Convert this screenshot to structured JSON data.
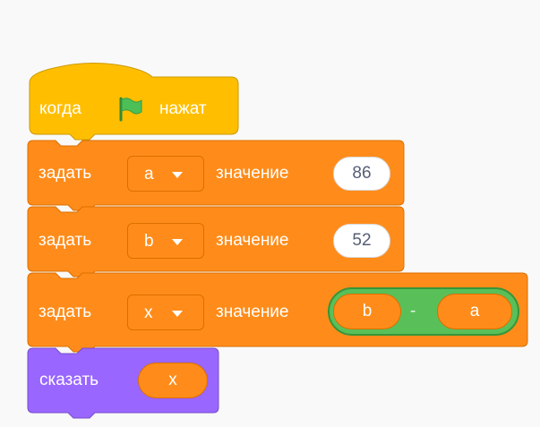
{
  "script": {
    "hat": {
      "prefix": "когда",
      "flag_icon": "green-flag-icon",
      "suffix": "нажат"
    },
    "set_blocks": [
      {
        "label": "задать",
        "variable": "a",
        "value_label": "значение",
        "value": "86"
      },
      {
        "label": "задать",
        "variable": "b",
        "value_label": "значение",
        "value": "52"
      },
      {
        "label": "задать",
        "variable": "x",
        "value_label": "значение",
        "operator": {
          "left": "b",
          "symbol": "-",
          "right": "a"
        }
      }
    ],
    "say_block": {
      "label": "сказать",
      "value": "x"
    }
  },
  "colors": {
    "events": "#ffbf00",
    "variables": "#ff8c1a",
    "operators": "#59c059",
    "looks": "#9966ff",
    "flag": "#4cbf56"
  }
}
